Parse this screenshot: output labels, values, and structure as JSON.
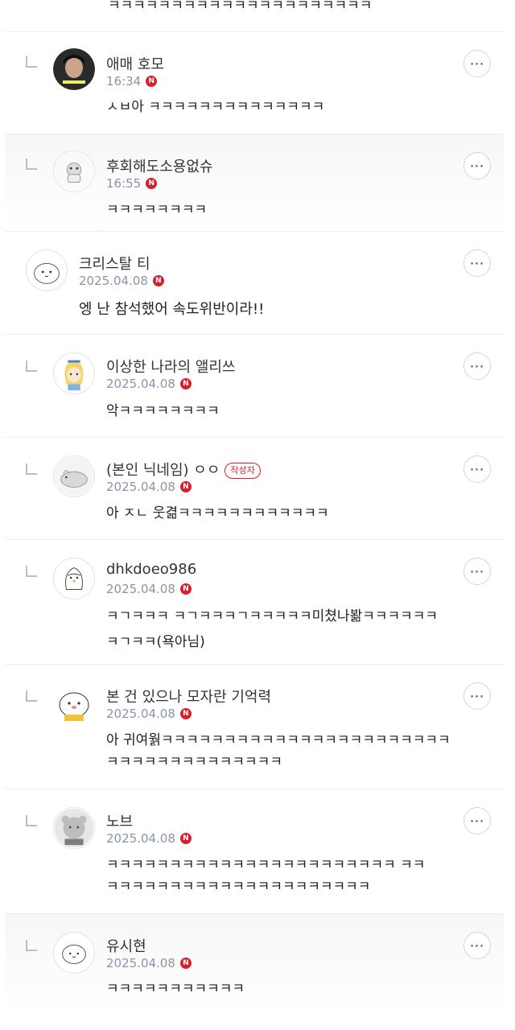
{
  "top_text": "ㅋㅋㅋㅋㅋㅋㅋㅋㅋㅋㅋㅋㅋㅋㅋㅋㅋㅋㅋㅋㅋ",
  "more_label": "⋯",
  "new_badge": "N",
  "author_tag": "작성자",
  "comments": [
    {
      "nick": "애매 호모",
      "time": "16:34",
      "lines": [
        "ㅅㅂ아 ㅋㅋㅋㅋㅋㅋㅋㅋㅋㅋㅋㅋㅋㅋ"
      ]
    },
    {
      "nick": "후회해도소용없슈",
      "time": "16:55",
      "lines": [
        "ㅋㅋㅋㅋㅋㅋㅋㅋ"
      ]
    },
    {
      "nick": "크리스탈 티",
      "time": "2025.04.08",
      "lines": [
        "엥 난 참석했어 속도위반이라!!"
      ]
    },
    {
      "nick": "이상한 나라의 앨리쓰",
      "time": "2025.04.08",
      "lines": [
        "악ㅋㅋㅋㅋㅋㅋㅋㅋ"
      ]
    },
    {
      "nick": "(본인 닉네임) ㅇㅇ",
      "time": "2025.04.08",
      "lines": [
        "아 ㅈㄴ 웃겲ㅋㅋㅋㅋㅋㅋㅋㅋㅋㅋㅋㅋ"
      ]
    },
    {
      "nick": "dhkdoeo986",
      "time": "2025.04.08",
      "lines": [
        "ㅋㄱㅋㅋㅋ ㅋㄱㅋㅋㅋㄱㅋㅋㅋㅋㅋ미쳤나봚ㅋㅋㅋㅋㅋㅋ",
        "ㅋㄱㅋㅋ(욕아님)"
      ]
    },
    {
      "nick": "본 건 있으나 모자란 기억력",
      "time": "2025.04.08",
      "lines": [
        "아 귀여웕ㅋㅋㅋㅋㅋㅋㅋㅋㅋㅋㅋㅋㅋㅋㅋㅋㅋㅋㅋㅋㅋㅋㅋ",
        "ㅋㅋㅋㅋㅋㅋㅋㅋㅋㅋㅋㅋㅋㅋ"
      ]
    },
    {
      "nick": "노브",
      "time": "2025.04.08",
      "lines": [
        "ㅋㅋㅋㅋㅋㅋㅋㅋㅋㅋㅋㅋㅋㅋㅋㅋㅋㅋㅋㅋㅋㅋㅋ ㅋㅋ",
        "ㅋㅋㅋㅋㅋㅋㅋㅋㅋㅋㅋㅋㅋㅋㅋㅋㅋㅋㅋㅋㅋ"
      ]
    },
    {
      "nick": "유시현",
      "time": "2025.04.08",
      "lines": [
        "ㅋㅋㅋㅋㅋㅋㅋㅋㅋㅋㅋ"
      ]
    }
  ]
}
